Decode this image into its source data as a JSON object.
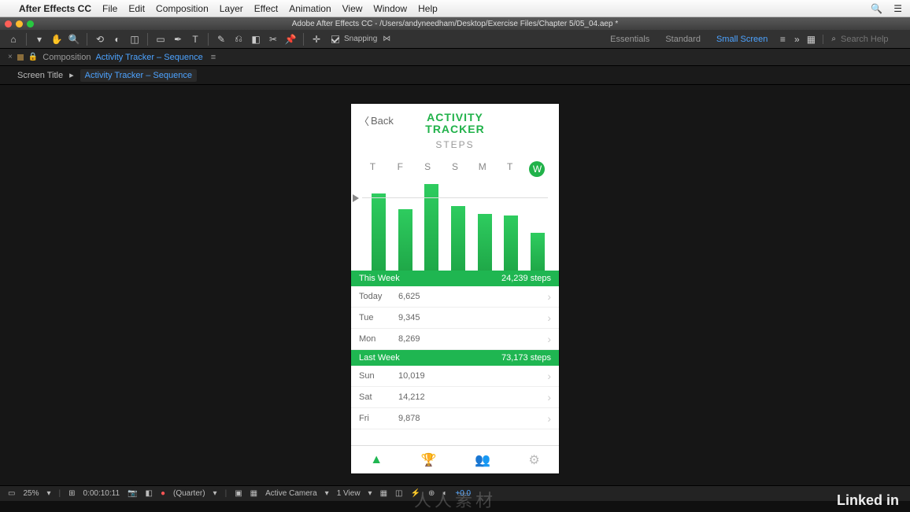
{
  "mac_menu": {
    "app": "After Effects CC",
    "items": [
      "File",
      "Edit",
      "Composition",
      "Layer",
      "Effect",
      "Animation",
      "View",
      "Window",
      "Help"
    ]
  },
  "title_bar": "Adobe After Effects CC - /Users/andyneedham/Desktop/Exercise Files/Chapter 5/05_04.aep *",
  "toolbar": {
    "snapping": "Snapping"
  },
  "workspaces": {
    "essentials": "Essentials",
    "standard": "Standard",
    "small": "Small Screen"
  },
  "search": {
    "placeholder": "Search Help"
  },
  "panel": {
    "label": "Composition",
    "name": "Activity Tracker – Sequence"
  },
  "breadcrumb": {
    "root": "Screen Title",
    "current": "Activity Tracker – Sequence"
  },
  "phone": {
    "back": "Back",
    "title1": "ACTIVITY",
    "title2": "TRACKER",
    "subtitle": "STEPS",
    "days": [
      "T",
      "F",
      "S",
      "S",
      "M",
      "T",
      "W"
    ],
    "this_week_label": "This Week",
    "this_week_total": "24,239 steps",
    "last_week_label": "Last Week",
    "last_week_total": "73,173 steps",
    "rows_this": [
      {
        "lbl": "Today",
        "val": "6,625"
      },
      {
        "lbl": "Tue",
        "val": "9,345"
      },
      {
        "lbl": "Mon",
        "val": "8,269"
      }
    ],
    "rows_last": [
      {
        "lbl": "Sun",
        "val": "10,019"
      },
      {
        "lbl": "Sat",
        "val": "14,212"
      },
      {
        "lbl": "Fri",
        "val": "9,878"
      }
    ]
  },
  "chart_data": {
    "type": "bar",
    "categories": [
      "T",
      "F",
      "S",
      "S",
      "M",
      "T",
      "W"
    ],
    "values": [
      98,
      78,
      110,
      82,
      72,
      70,
      48
    ],
    "title": "STEPS",
    "xlabel": "",
    "ylabel": "",
    "ylim": [
      0,
      115
    ],
    "note": "values are approximate relative bar heights in px; no y-axis labels visible"
  },
  "footer": {
    "zoom": "25%",
    "timecode": "0:00:10:11",
    "res": "(Quarter)",
    "camera": "Active Camera",
    "views": "1 View",
    "offset": "+0.0"
  },
  "watermark": "人人素材",
  "linkedin": "Linked in"
}
